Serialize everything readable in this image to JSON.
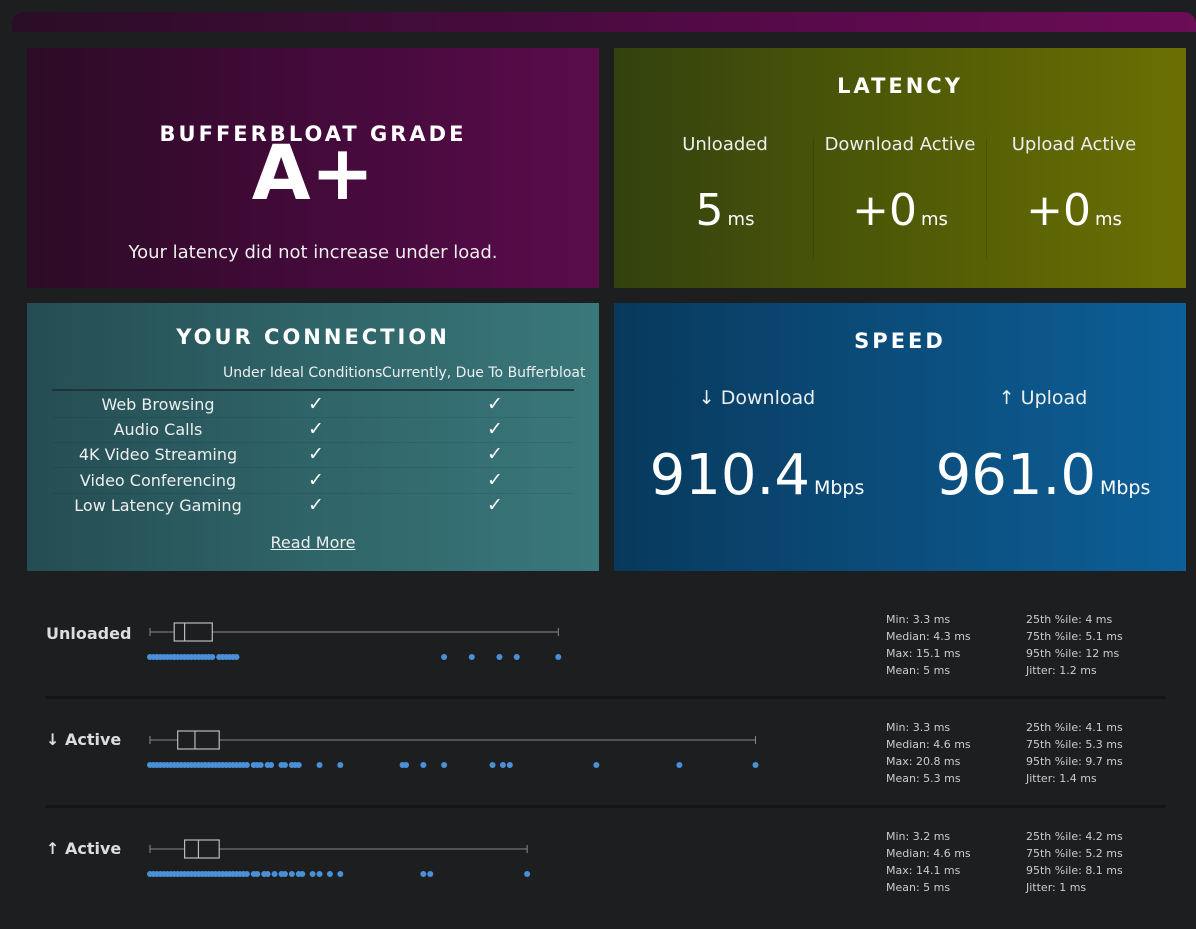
{
  "grade": {
    "title": "BUFFERBLOAT GRADE",
    "value": "A+",
    "description": "Your latency did not increase under load."
  },
  "latency": {
    "title": "LATENCY",
    "columns": [
      {
        "label": "Unloaded",
        "value": "5",
        "unit": "ms"
      },
      {
        "label": "Download Active",
        "value": "+0",
        "unit": "ms"
      },
      {
        "label": "Upload Active",
        "value": "+0",
        "unit": "ms"
      }
    ]
  },
  "connection": {
    "title": "YOUR CONNECTION",
    "header_ideal": "Under Ideal Conditions",
    "header_current": "Currently, Due To Bufferbloat",
    "rows": [
      {
        "task": "Web Browsing",
        "ideal": "✓",
        "current": "✓"
      },
      {
        "task": "Audio Calls",
        "ideal": "✓",
        "current": "✓"
      },
      {
        "task": "4K Video Streaming",
        "ideal": "✓",
        "current": "✓"
      },
      {
        "task": "Video Conferencing",
        "ideal": "✓",
        "current": "✓"
      },
      {
        "task": "Low Latency Gaming",
        "ideal": "✓",
        "current": "✓"
      }
    ],
    "read_more": "Read More"
  },
  "speed": {
    "title": "SPEED",
    "download": {
      "label": "↓ Download",
      "value": "910.4",
      "unit": "Mbps"
    },
    "upload": {
      "label": "↑ Upload",
      "value": "961.0",
      "unit": "Mbps"
    }
  },
  "colors": {
    "point": "#4a90d9",
    "box": "#bbbbbb"
  },
  "stats": [
    {
      "label": "Unloaded",
      "min": "Min: 3.3 ms",
      "median": "Median: 4.3 ms",
      "max": "Max: 15.1 ms",
      "mean": "Mean: 5 ms",
      "p25": "25th %ile: 4 ms",
      "p75": "75th %ile: 5.1 ms",
      "p95": "95th %ile: 12 ms",
      "jitter": "Jitter: 1.2 ms",
      "box": {
        "min": 3.3,
        "q1": 4,
        "median": 4.3,
        "q3": 5.1,
        "max": 15.1
      },
      "points": [
        3.3,
        3.4,
        3.5,
        3.5,
        3.6,
        3.7,
        3.8,
        3.9,
        4.0,
        4.0,
        4.1,
        4.2,
        4.3,
        4.4,
        4.5,
        4.6,
        4.7,
        4.8,
        4.9,
        5.0,
        5.1,
        5.3,
        5.4,
        5.5,
        5.6,
        5.7,
        5.8,
        11.8,
        12.6,
        13.4,
        13.9,
        15.1
      ]
    },
    {
      "label": "↓ Active",
      "min": "Min: 3.3 ms",
      "median": "Median: 4.6 ms",
      "max": "Max: 20.8 ms",
      "mean": "Mean: 5.3 ms",
      "p25": "25th %ile: 4.1 ms",
      "p75": "75th %ile: 5.3 ms",
      "p95": "95th %ile: 9.7 ms",
      "jitter": "Jitter: 1.4 ms",
      "box": {
        "min": 3.3,
        "q1": 4.1,
        "median": 4.6,
        "q3": 5.3,
        "max": 20.8
      },
      "points": [
        3.3,
        3.4,
        3.5,
        3.6,
        3.7,
        3.8,
        3.9,
        4.0,
        4.1,
        4.2,
        4.3,
        4.4,
        4.5,
        4.6,
        4.7,
        4.8,
        4.9,
        5.0,
        5.1,
        5.2,
        5.3,
        5.4,
        5.5,
        5.6,
        5.7,
        5.8,
        5.9,
        6.0,
        6.1,
        6.3,
        6.4,
        6.5,
        6.7,
        6.8,
        7.1,
        7.2,
        7.4,
        7.5,
        7.6,
        8.2,
        8.8,
        10.6,
        10.7,
        11.2,
        11.8,
        13.2,
        13.5,
        13.7,
        16.2,
        18.6,
        20.8
      ]
    },
    {
      "label": "↑ Active",
      "min": "Min: 3.2 ms",
      "median": "Median: 4.6 ms",
      "max": "Max: 14.1 ms",
      "mean": "Mean: 5 ms",
      "p25": "25th %ile: 4.2 ms",
      "p75": "75th %ile: 5.2 ms",
      "p95": "95th %ile: 8.1 ms",
      "jitter": "Jitter: 1 ms",
      "box": {
        "min": 3.2,
        "q1": 4.2,
        "median": 4.6,
        "q3": 5.2,
        "max": 14.1
      },
      "points": [
        3.2,
        3.3,
        3.4,
        3.5,
        3.6,
        3.7,
        3.8,
        3.9,
        4.0,
        4.1,
        4.2,
        4.3,
        4.4,
        4.5,
        4.6,
        4.7,
        4.8,
        4.9,
        5.0,
        5.1,
        5.2,
        5.3,
        5.4,
        5.5,
        5.6,
        5.7,
        5.8,
        5.9,
        6.0,
        6.2,
        6.3,
        6.5,
        6.6,
        6.8,
        7.0,
        7.1,
        7.3,
        7.5,
        7.6,
        7.9,
        8.1,
        8.4,
        8.7,
        11.1,
        11.3,
        14.1
      ]
    }
  ]
}
